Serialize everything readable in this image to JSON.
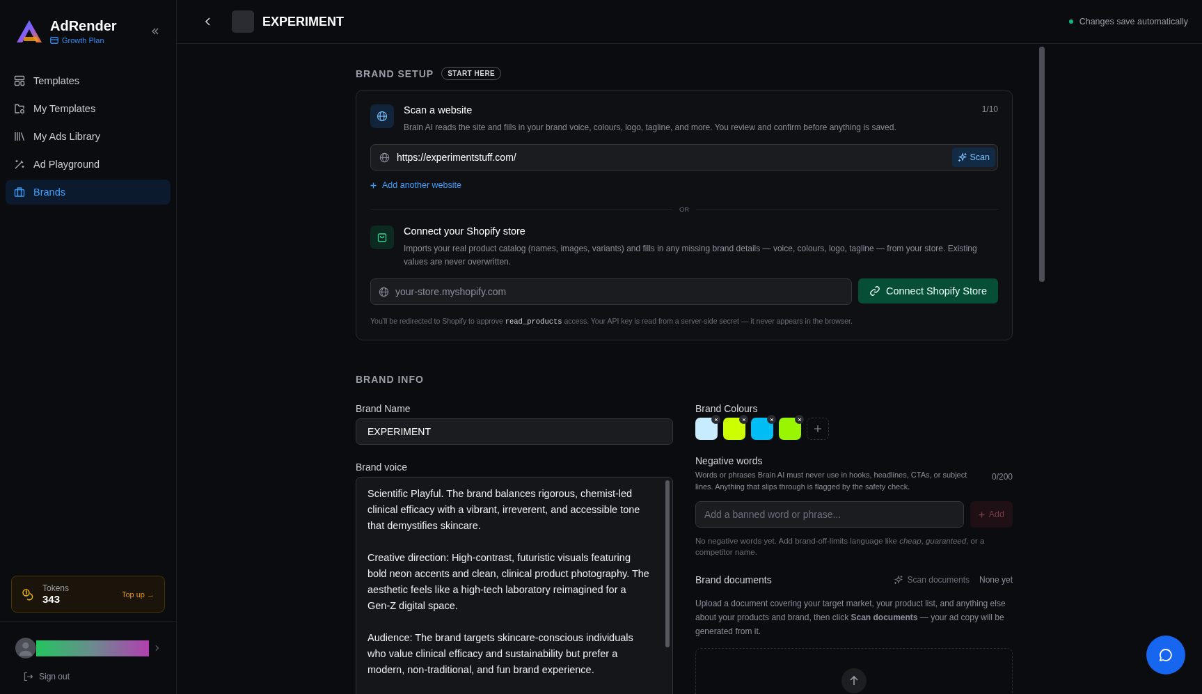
{
  "sidebar": {
    "app_name": "AdRender",
    "plan": "Growth Plan",
    "items": [
      {
        "label": "Templates",
        "selected": false
      },
      {
        "label": "My Templates",
        "selected": false
      },
      {
        "label": "My Ads Library",
        "selected": false
      },
      {
        "label": "Ad Playground",
        "selected": false
      },
      {
        "label": "Brands",
        "selected": true
      }
    ],
    "tokens": {
      "label": "Tokens",
      "value": "343",
      "action": "Top up →"
    },
    "sign_out": "Sign out"
  },
  "header": {
    "title": "EXPERIMENT",
    "status": "Changes save automatically"
  },
  "brand_setup": {
    "heading": "BRAND SETUP",
    "badge": "START HERE",
    "scan": {
      "title": "Scan a website",
      "description": "Brain AI reads the site and fills in your brand voice, colours, logo, tagline, and more. You review and confirm before anything is saved.",
      "count": "1/10",
      "url": "https://experimentstuff.com/",
      "button": "Scan",
      "add_link": "Add another website"
    },
    "divider": "OR",
    "shopify": {
      "title": "Connect your Shopify store",
      "description": "Imports your real product catalog (names, images, variants) and fills in any missing brand details — voice, colours, logo, tagline — from your store. Existing values are never overwritten.",
      "placeholder": "your-store.myshopify.com",
      "button": "Connect Shopify Store",
      "note": [
        {
          "kind": "plain",
          "text": "You'll be redirected to Shopify to approve "
        },
        {
          "kind": "code",
          "text": "read_products"
        },
        {
          "kind": "plain",
          "text": " access. Your API key is read from a server-side secret — it never appears in the browser."
        }
      ]
    }
  },
  "brand_info": {
    "heading": "BRAND INFO",
    "brand_name": {
      "label": "Brand Name",
      "value": "EXPERIMENT"
    },
    "brand_voice": {
      "label": "Brand voice",
      "value": "Scientific Playful. The brand balances rigorous, chemist-led clinical efficacy with a vibrant, irreverent, and accessible tone that demystifies skincare.\n\nCreative direction: High-contrast, futuristic visuals featuring bold neon accents and clean, clinical product photography. The aesthetic feels like a high-tech laboratory reimagined for a Gen-Z digital space.\n\nAudience: The brand targets skincare-conscious individuals who value clinical efficacy and sustainability but prefer a modern, non-traditional, and fun brand experience."
    },
    "brand_colours": {
      "label": "Brand Colours",
      "colors": [
        {
          "color": "#c8ecff"
        },
        {
          "color": "#ccff00"
        },
        {
          "color": "#00bdf5"
        },
        {
          "color": "#99f500"
        }
      ]
    },
    "negative_words": {
      "label": "Negative words",
      "description": "Words or phrases Brain AI must never use in hooks, headlines, CTAs, or subject lines. Anything that slips through is flagged by the safety check.",
      "count": "0/200",
      "placeholder": "Add a banned word or phrase...",
      "button": "Add",
      "disabled": true,
      "empty_hint": "No negative words yet. Add brand-off-limits language like *cheap*, *guaranteed*, or a competitor name."
    },
    "brand_documents": {
      "label": "Brand documents",
      "scan_button": "Scan documents",
      "status": "None yet",
      "description": "Upload a document covering your target market, your product list, and anything else about your products and brand, then click **Scan documents** — your ad copy will be generated from it."
    }
  }
}
